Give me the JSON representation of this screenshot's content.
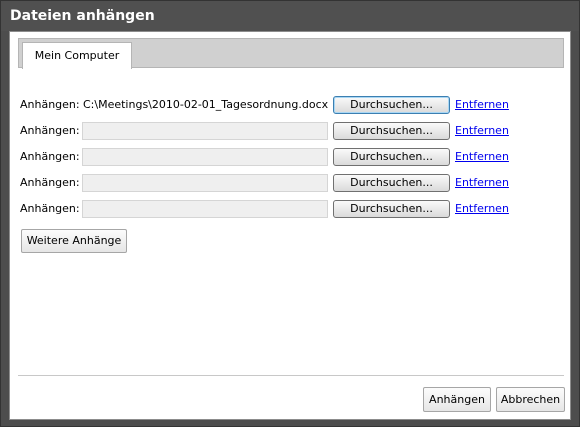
{
  "window": {
    "title": "Dateien anhängen"
  },
  "tabs": [
    {
      "label": "Mein Computer",
      "selected": true
    }
  ],
  "rows": [
    {
      "label": "Anhängen:",
      "value": "C:\\Meetings\\2010-02-01_Tagesordnung.docx",
      "browse_label": "Durchsuchen...",
      "remove_label": "Entfernen"
    },
    {
      "label": "Anhängen:",
      "value": "",
      "browse_label": "Durchsuchen...",
      "remove_label": "Entfernen"
    },
    {
      "label": "Anhängen:",
      "value": "",
      "browse_label": "Durchsuchen...",
      "remove_label": "Entfernen"
    },
    {
      "label": "Anhängen:",
      "value": "",
      "browse_label": "Durchsuchen...",
      "remove_label": "Entfernen"
    },
    {
      "label": "Anhängen:",
      "value": "",
      "browse_label": "Durchsuchen...",
      "remove_label": "Entfernen"
    }
  ],
  "more_button": {
    "label": "Weitere Anhänge"
  },
  "footer": {
    "attach_label": "Anhängen",
    "cancel_label": "Abbrechen"
  },
  "colors": {
    "titlebar": "#505050",
    "frame": "#4d4d4d",
    "link": "#0000ee",
    "tabstrip": "#d0d0d0"
  }
}
